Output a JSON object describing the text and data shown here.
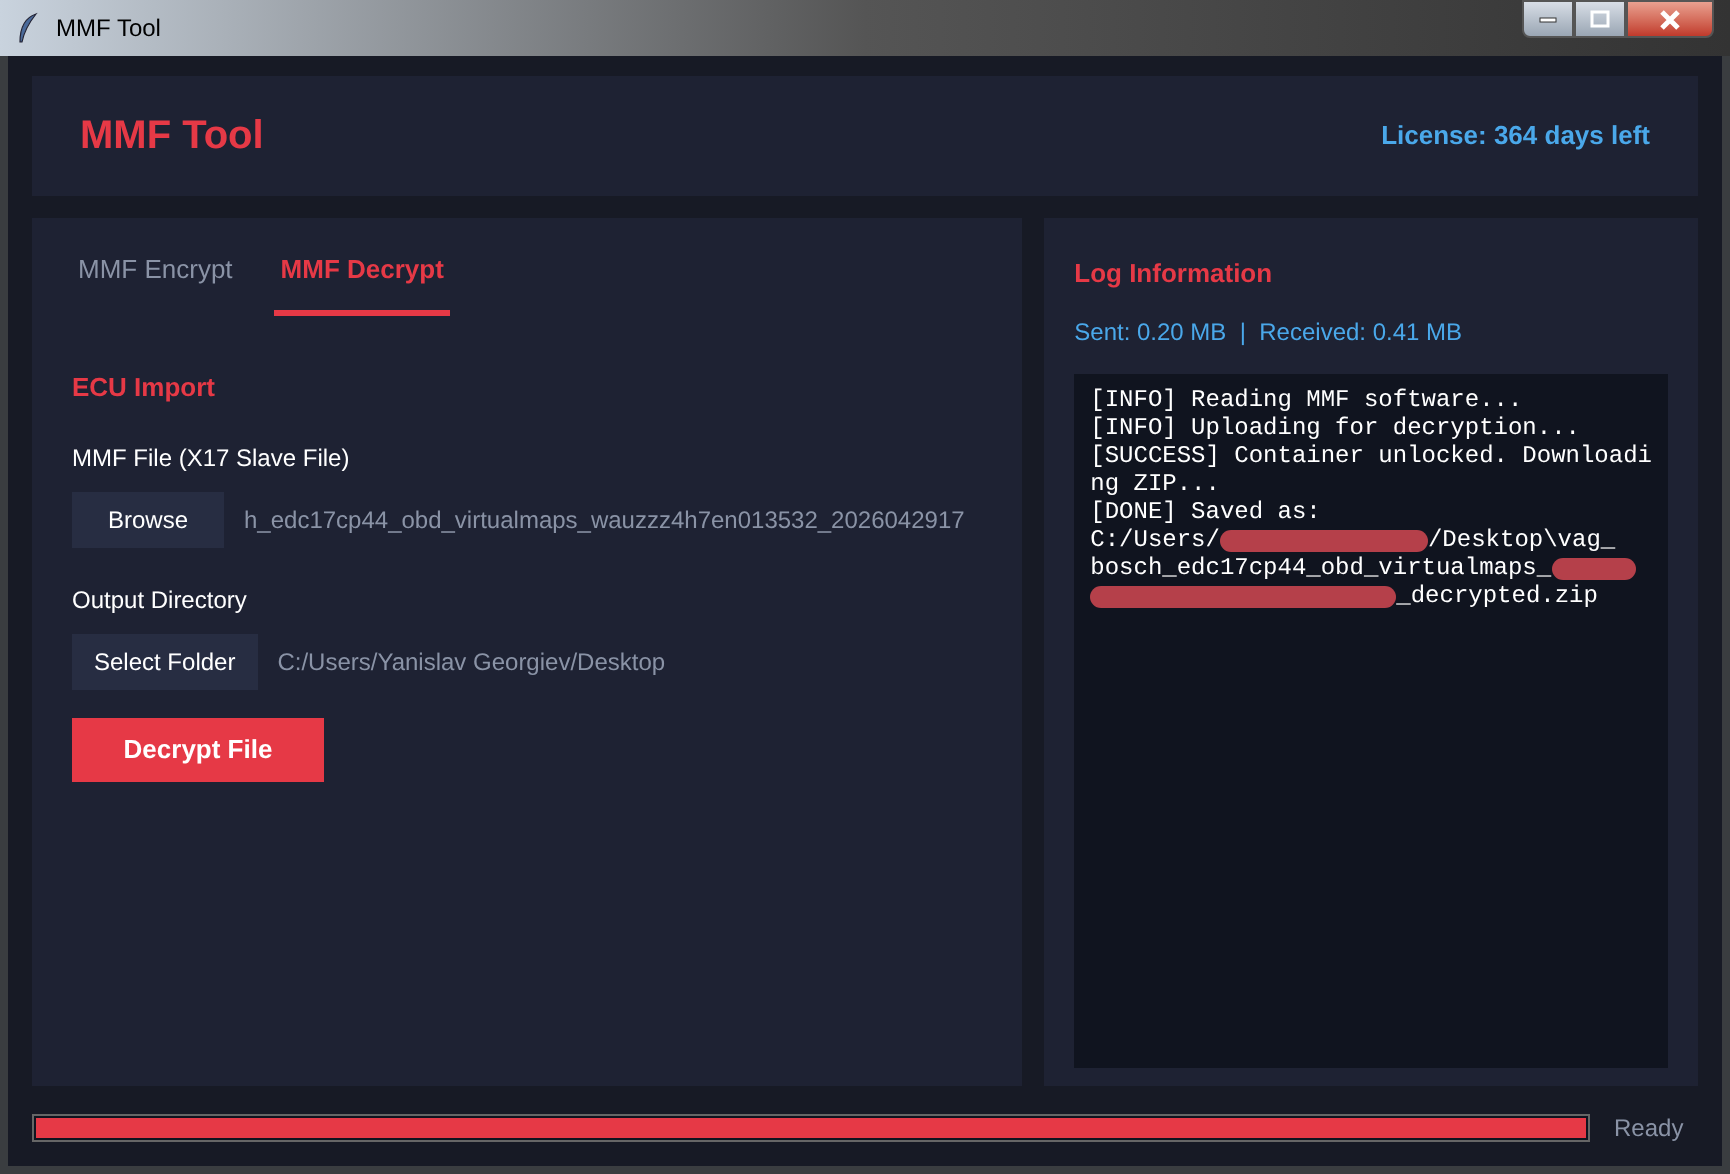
{
  "window": {
    "title": "MMF Tool"
  },
  "header": {
    "title": "MMF Tool",
    "license": "License: 364 days left"
  },
  "tabs": [
    {
      "label": "MMF Encrypt",
      "selected": false
    },
    {
      "label": "MMF Decrypt",
      "selected": true
    }
  ],
  "section_title": "ECU Import",
  "fields": [
    {
      "label": "MMF File (X17 Slave File)",
      "button": "Browse",
      "value": "h_edc17cp44_obd_virtualmaps_wauzzz4h7en013532_2026042917"
    },
    {
      "label": "Output Directory",
      "button": "Select Folder",
      "value": "C:/Users/Yanislav Georgiev/Desktop"
    }
  ],
  "action_button": "Decrypt File",
  "log": {
    "title": "Log Information",
    "stats": "Sent: 0.20 MB  |  Received: 0.41 MB",
    "lines": [
      [
        {
          "kind": "text",
          "text": "[INFO] Reading MMF software..."
        }
      ],
      [
        {
          "kind": "text",
          "text": "[INFO] Uploading for decryption..."
        }
      ],
      [
        {
          "kind": "text",
          "text": "[SUCCESS] Container unlocked. Downloadi"
        }
      ],
      [
        {
          "kind": "text",
          "text": "ng ZIP..."
        }
      ],
      [
        {
          "kind": "text",
          "text": "[DONE] Saved as:"
        }
      ],
      [
        {
          "kind": "text",
          "text": "C:/Users/"
        },
        {
          "kind": "redaction"
        },
        {
          "kind": "text",
          "text": "/Desktop\\vag_"
        }
      ],
      [
        {
          "kind": "text",
          "text": "bosch_edc17cp44_obd_virtualmaps_"
        },
        {
          "kind": "redaction"
        }
      ],
      [
        {
          "kind": "redaction"
        },
        {
          "kind": "text",
          "text": "_decrypted.zip"
        }
      ]
    ]
  },
  "status_bar": {
    "level": 1,
    "text": "Ready"
  }
}
